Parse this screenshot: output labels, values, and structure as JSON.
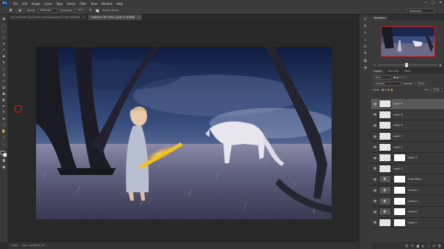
{
  "app": {
    "logo": "Ps"
  },
  "menu": [
    "File",
    "Edit",
    "Image",
    "Layer",
    "Type",
    "Select",
    "Filter",
    "View",
    "Window",
    "Help"
  ],
  "window_controls": [
    "—",
    "▢",
    "✕"
  ],
  "options": {
    "range_label": "Range:",
    "range_value": "Midtones",
    "exposure_label": "Exposure:",
    "exposure_value": "50%",
    "protect_tones": "Protect Tones",
    "workspace": "Essentials"
  },
  "tabs": [
    {
      "label": "fire_stock001_by_kirsten_stocktaee.jpg @ 100% (RGB/8)",
      "close": "×"
    },
    {
      "label": "Untitled-1 @ 100% (Layer 9, RGB/8)",
      "close": "×"
    }
  ],
  "statusbar": {
    "zoom": "100%",
    "doc": "Doc: 2.49M/73.1M"
  },
  "panels": {
    "navigator_tabs": [
      "Navigator"
    ],
    "layers_tabs": [
      "Layers",
      "Channels",
      "Paths"
    ],
    "kind_filter": "Kind",
    "blend_mode": "Overlay",
    "opacity_label": "Opacity:",
    "opacity_value": "100%",
    "lock_label": "Lock:",
    "fill_label": "Fill:",
    "fill_value": "100%"
  },
  "layers": [
    {
      "name": "Layer 9",
      "type": "pixel",
      "mask": false,
      "selected": true
    },
    {
      "name": "Layer 8",
      "type": "pixel",
      "mask": false
    },
    {
      "name": "Layer 6",
      "type": "pixel",
      "mask": false
    },
    {
      "name": "Layer 7",
      "type": "pixel",
      "mask": false
    },
    {
      "name": "Layer 5",
      "type": "pixel",
      "mask": false
    },
    {
      "name": "Layer 3",
      "type": "pixel",
      "mask": true
    },
    {
      "name": "Layer 1",
      "type": "pixel",
      "mask": false
    },
    {
      "name": "Color Bala...",
      "type": "adjustment",
      "mask": true
    },
    {
      "name": "Curves 1",
      "type": "adjustment",
      "mask": true
    },
    {
      "name": "Levels 1",
      "type": "adjustment",
      "mask": true
    },
    {
      "name": "Levels 2",
      "type": "adjustment",
      "mask": true
    },
    {
      "name": "Layer 2",
      "type": "pixel",
      "mask": true
    }
  ]
}
